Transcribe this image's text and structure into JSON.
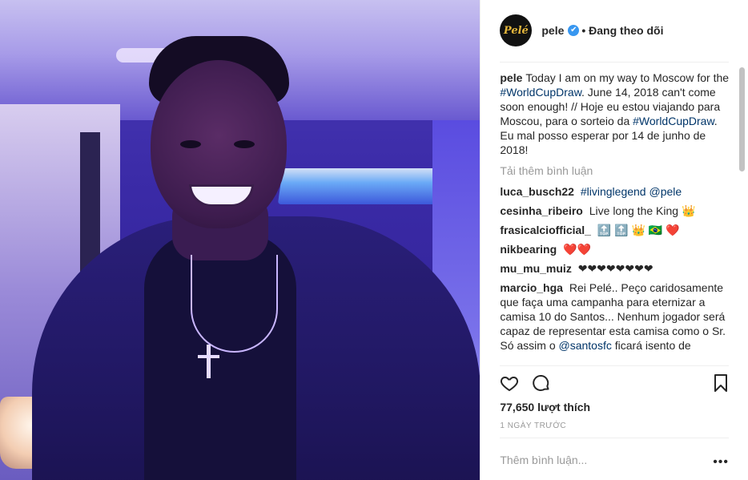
{
  "header": {
    "avatar_text": "Pelé",
    "username": "pele",
    "verified_icon": "✔",
    "follow_status": "• Đang theo dõi"
  },
  "caption": {
    "user": "pele",
    "parts": [
      "Today I am on my way to Moscow for the",
      "#WorldCupDraw",
      ". June 14, 2018 can't come soon enough! // Hoje eu estou viajando para Moscou, para o sorteio da",
      "#WorldCupDraw",
      ". Eu mal posso esperar por 14 de junho de 2018!"
    ]
  },
  "load_more": "Tải thêm bình luận",
  "comments": [
    {
      "user": "luca_busch22",
      "text_a": "#livinglegend",
      "text_b": "@pele"
    },
    {
      "user": "cesinha_ribeiro",
      "text": "Live long the King 👑"
    },
    {
      "user": "frasicalciofficial_",
      "text": "🔝 🔝 👑 🇧🇷 ❤️"
    },
    {
      "user": "nikbearing",
      "text": "❤️❤️"
    },
    {
      "user": "mu_mu_muiz",
      "text": "❤❤❤❤❤❤❤❤"
    },
    {
      "user": "marcio_hga",
      "text": "Rei Pelé.. Peço caridosamente que faça uma campanha para eternizar a camisa 10 do Santos... Nenhum jogador será capaz de representar esta camisa como o Sr. Só assim o",
      "mention": "@santosfc",
      "tail": "ficará isento de"
    }
  ],
  "stats": {
    "likes": "77,650 lượt thích",
    "time": "1 NGÀY TRƯỚC"
  },
  "add_comment_placeholder": "Thêm bình luận...",
  "more_icon": "•••",
  "colors": {
    "link": "#003569",
    "muted": "#999999",
    "verified": "#3897f0"
  }
}
